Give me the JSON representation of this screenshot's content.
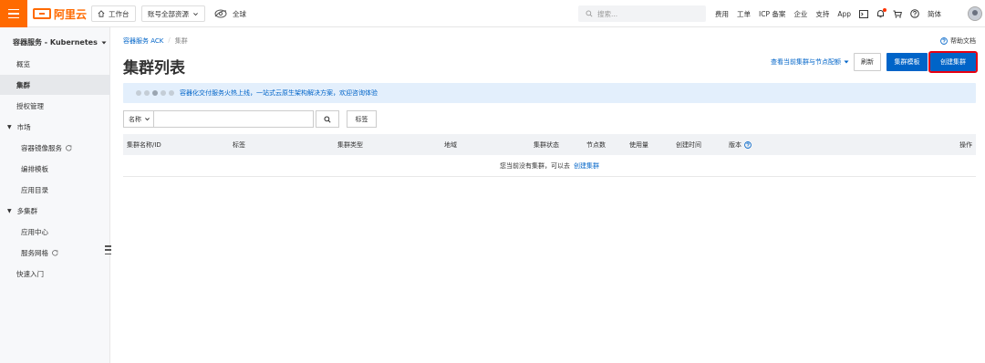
{
  "topbar": {
    "logo_text": "阿里云",
    "workbench": "工作台",
    "account_resources": "账号全部资源",
    "region": "全球",
    "search_placeholder": "搜索...",
    "links": [
      "费用",
      "工单",
      "ICP 备案",
      "企业",
      "支持",
      "App"
    ],
    "language": "简体"
  },
  "sidebar": {
    "title": "容器服务 - Kubernetes",
    "items": [
      {
        "label": "概览"
      },
      {
        "label": "集群"
      },
      {
        "label": "授权管理"
      },
      {
        "label": "市场"
      },
      {
        "label": "容器镜像服务"
      },
      {
        "label": "编排模板"
      },
      {
        "label": "应用目录"
      },
      {
        "label": "多集群"
      },
      {
        "label": "应用中心"
      },
      {
        "label": "服务网格"
      },
      {
        "label": "快速入门"
      }
    ]
  },
  "main": {
    "breadcrumb": [
      "容器服务 ACK",
      "集群"
    ],
    "breadcrumb_sep": "/",
    "help_docs": "帮助文档",
    "title": "集群列表",
    "view_quota_link": "查看当前集群与节点配额",
    "buttons": {
      "refresh": "刷新",
      "template": "集群模板",
      "create": "创建集群"
    },
    "banner": "容器化交付服务火热上线，一站式云原生架构解决方案，欢迎咨询体验",
    "filter": {
      "select_value": "名称",
      "input_value": "",
      "tag_button": "标签"
    },
    "table": {
      "columns": [
        "集群名称/ID",
        "标签",
        "集群类型",
        "地域",
        "集群状态",
        "节点数",
        "使用量",
        "创建时间",
        "版本",
        "操作"
      ],
      "empty_text": "您当前没有集群，可以去",
      "empty_link": "创建集群"
    }
  },
  "colors": {
    "brand": "#ff6a00",
    "primary": "#0064c8",
    "highlight_outline": "#e60012",
    "banner_bg": "#e3effc"
  }
}
